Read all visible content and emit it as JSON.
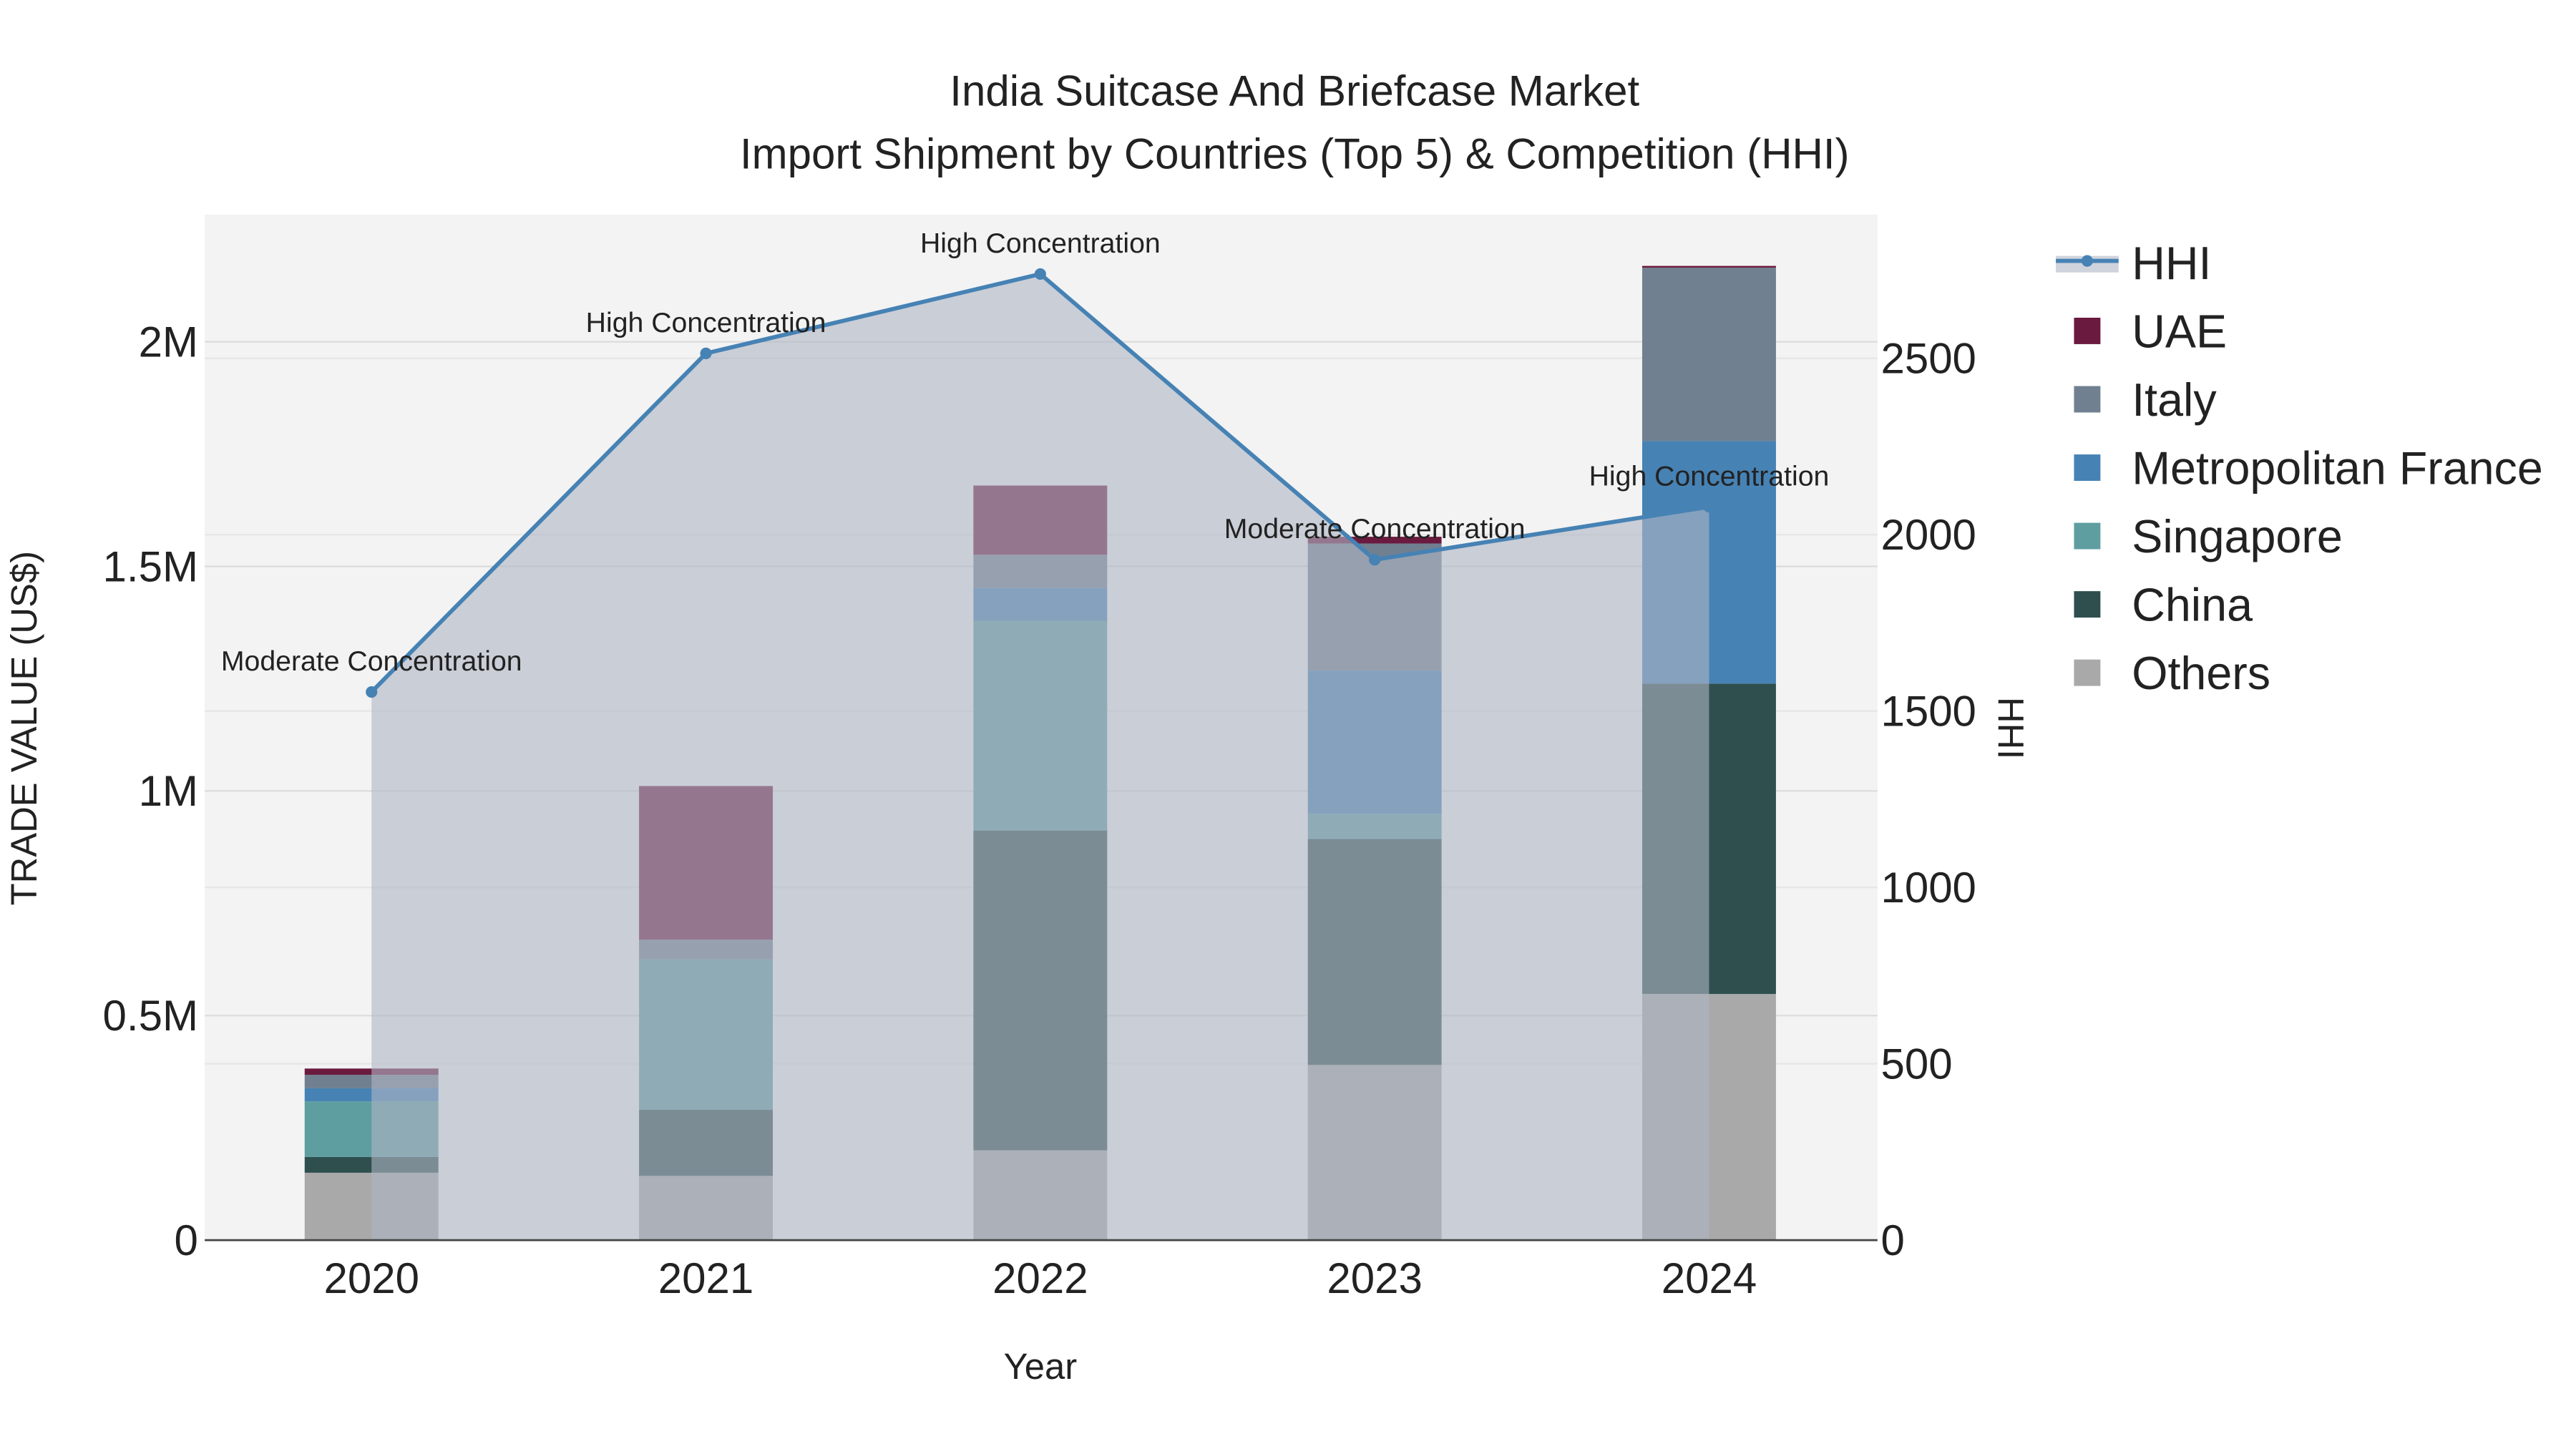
{
  "chart_data": {
    "type": "bar",
    "title": "India Suitcase And Briefcase Market",
    "subtitle": "Import Shipment by Countries (Top 5) & Competition (HHI)",
    "xlabel": "Year",
    "ylabel": "TRADE VALUE (US$)",
    "y2label": "HHI",
    "categories": [
      "2020",
      "2021",
      "2022",
      "2023",
      "2024"
    ],
    "ylim": [
      0,
      2280000
    ],
    "y2lim": [
      0,
      2900
    ],
    "yticks": [
      {
        "v": 0,
        "label": "0"
      },
      {
        "v": 500000,
        "label": "0.5M"
      },
      {
        "v": 1000000,
        "label": "1M"
      },
      {
        "v": 1500000,
        "label": "1.5M"
      },
      {
        "v": 2000000,
        "label": "2M"
      }
    ],
    "y2ticks": [
      {
        "v": 0,
        "label": "0"
      },
      {
        "v": 500,
        "label": "500"
      },
      {
        "v": 1000,
        "label": "1000"
      },
      {
        "v": 1500,
        "label": "1500"
      },
      {
        "v": 2000,
        "label": "2000"
      },
      {
        "v": 2500,
        "label": "2500"
      }
    ],
    "grid": true,
    "legend_position": "right",
    "series": [
      {
        "name": "Others",
        "color": "#a9a9a9",
        "values": [
          150000,
          143000,
          200000,
          390000,
          548000
        ]
      },
      {
        "name": "China",
        "color": "#2f4f4f",
        "values": [
          35000,
          147000,
          712000,
          503000,
          691000
        ]
      },
      {
        "name": "Singapore",
        "color": "#5f9ea0",
        "values": [
          124000,
          335000,
          467000,
          56000,
          0
        ]
      },
      {
        "name": "Metropolitan France",
        "color": "#4682b4",
        "values": [
          29000,
          0,
          73000,
          319000,
          540000
        ]
      },
      {
        "name": "Italy",
        "color": "#708090",
        "values": [
          30000,
          44000,
          74000,
          283000,
          386000
        ]
      },
      {
        "name": "UAE",
        "color": "#6b1a3f",
        "values": [
          14000,
          342000,
          154000,
          15000,
          4000
        ]
      }
    ],
    "line": {
      "name": "HHI",
      "color": "#4682b4",
      "values": [
        1554,
        2514,
        2739,
        1929,
        2079
      ],
      "annotations": [
        "Moderate Concentration",
        "High Concentration",
        "High Concentration",
        "Moderate Concentration",
        "High Concentration"
      ]
    },
    "legend_order": [
      "HHI",
      "UAE",
      "Italy",
      "Metropolitan France",
      "Singapore",
      "China",
      "Others"
    ]
  }
}
